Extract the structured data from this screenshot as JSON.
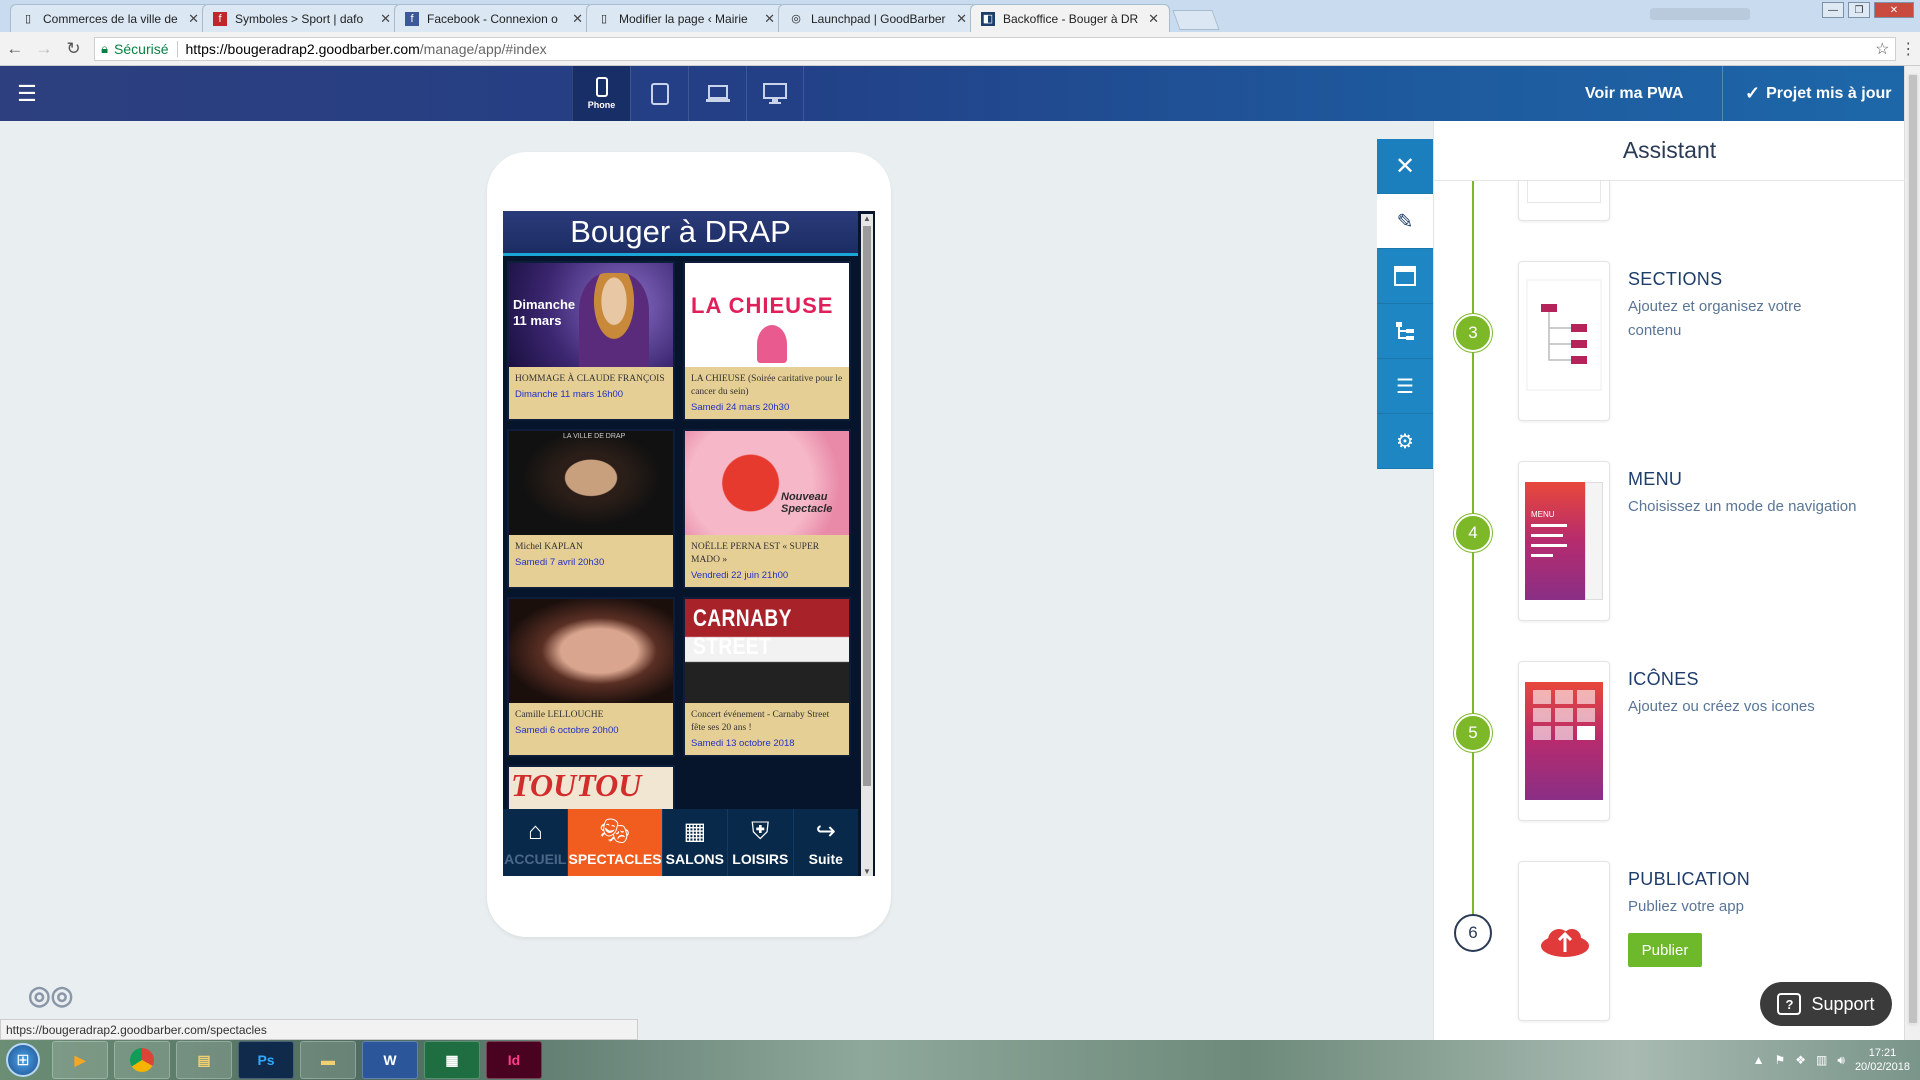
{
  "browser": {
    "tabs": [
      {
        "title": "Commerces de la ville de",
        "favicon": "page-icon"
      },
      {
        "title": "Symboles > Sport | dafo",
        "favicon": "dafont-icon"
      },
      {
        "title": "Facebook - Connexion o",
        "favicon": "facebook-icon"
      },
      {
        "title": "Modifier la page ‹ Mairie",
        "favicon": "page-icon"
      },
      {
        "title": "Launchpad | GoodBarber",
        "favicon": "goodbarber-icon"
      },
      {
        "title": "Backoffice - Bouger à DR",
        "favicon": "backoffice-icon"
      }
    ],
    "secure_label": "Sécurisé",
    "url_host": "https://bougeradrap2.goodbarber.com",
    "url_path": "/manage/app/#index",
    "status_url": "https://bougeradrap2.goodbarber.com/spectacles"
  },
  "topbar": {
    "device_phone_label": "Phone",
    "voir_pwa": "Voir ma PWA",
    "projet": "Projet mis à jour"
  },
  "preview": {
    "app_title": "Bouger à DRAP",
    "cards": [
      {
        "title": "HOMMAGE À CLAUDE FRANÇOIS",
        "date": "Dimanche 11 mars 16h00",
        "img_text": "Dimanche 11 mars"
      },
      {
        "title": "LA CHIEUSE (Soirée caritative pour le cancer du sein)",
        "date": "Samedi 24 mars 20h30",
        "img_text": "LA CHIEUSE"
      },
      {
        "title": "Michel KAPLAN",
        "date": "Samedi 7 avril 20h30",
        "img_text": "LA VILLE DE DRAP"
      },
      {
        "title": "NOËLLE PERNA EST « SUPER MADO »",
        "date": "Vendredi 22 juin 21h00",
        "img_text": "Nouveau Spectacle"
      },
      {
        "title": "Camille LELLOUCHE",
        "date": "Samedi 6 octobre 20h00",
        "img_text": ""
      },
      {
        "title": "Concert événement - Carnaby Street fête ses 20 ans !",
        "date": "Samedi 13 octobre 2018",
        "img_text": "CARNABY STREET"
      }
    ],
    "partial_card_text": "TOUTOU",
    "tabs": [
      {
        "label": "ACCUEIL",
        "icon": "home-icon"
      },
      {
        "label": "SPECTACLES",
        "icon": "theater-icon"
      },
      {
        "label": "SALONS",
        "icon": "calendar-icon"
      },
      {
        "label": "LOISIRS",
        "icon": "crest-icon"
      },
      {
        "label": "Suite",
        "icon": "share-arrow-icon"
      }
    ]
  },
  "assistant": {
    "title": "Assistant",
    "steps": [
      {
        "num": "3",
        "title": "SECTIONS",
        "desc": "Ajoutez et organisez votre contenu"
      },
      {
        "num": "4",
        "title": "MENU",
        "desc": "Choisissez un mode de navigation",
        "thumb_text": "MENU"
      },
      {
        "num": "5",
        "title": "ICÔNES",
        "desc": "Ajoutez ou créez vos icones"
      },
      {
        "num": "6",
        "title": "PUBLICATION",
        "desc": "Publiez votre app",
        "button": "Publier"
      }
    ]
  },
  "support_label": "Support",
  "taskbar": {
    "time": "17:21",
    "date": "20/02/2018"
  },
  "colors": {
    "accent_green": "#7cb828",
    "sidebar_blue": "#1e87c3",
    "active_tab_orange": "#f15c1f",
    "card_bg": "#e6cf94"
  }
}
